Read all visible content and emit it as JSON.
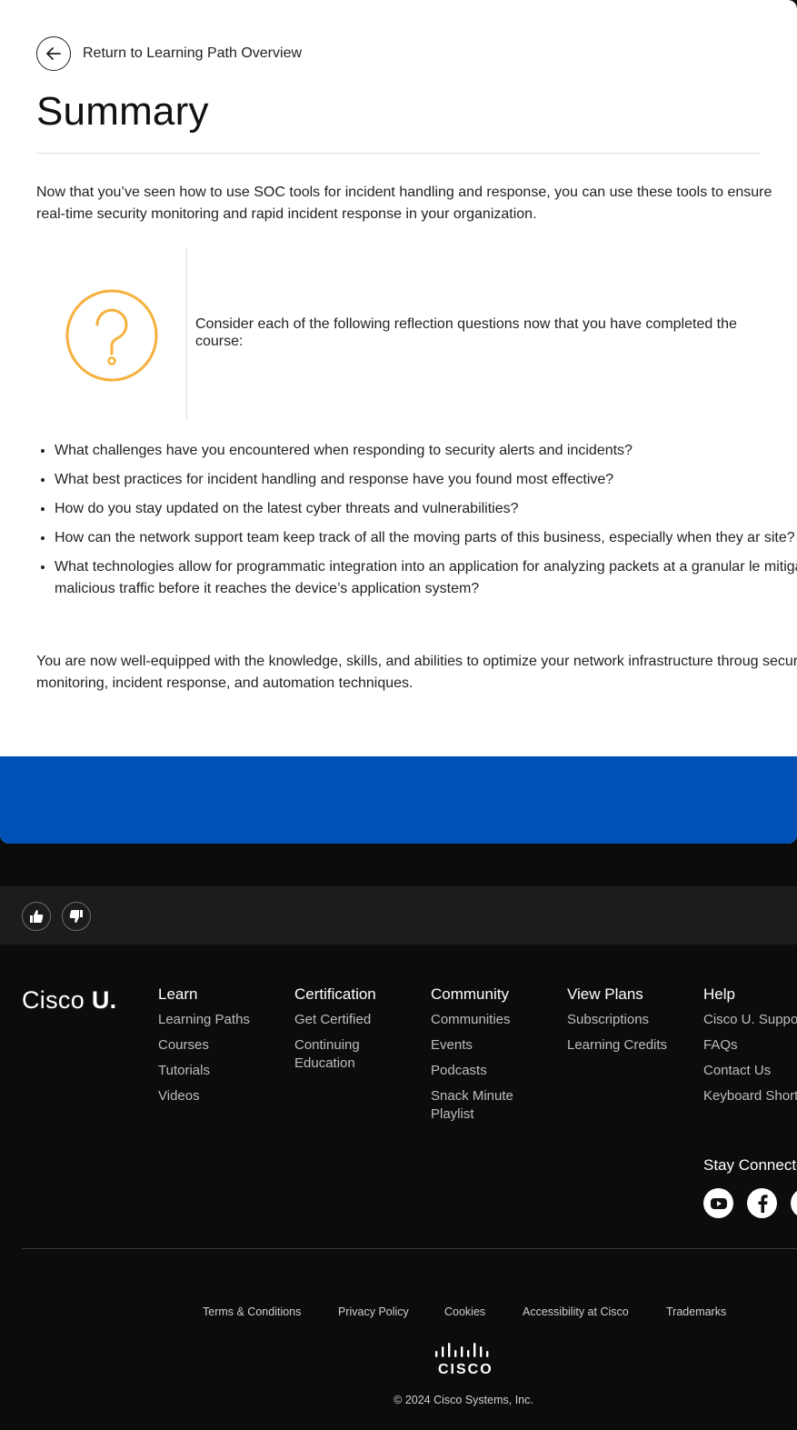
{
  "nav": {
    "back_label": "Return to Learning Path Overview"
  },
  "page": {
    "title": "Summary",
    "intro": "Now that you’ve seen how to use SOC tools for incident handling and response, you can use these tools to ensure real-time security monitoring and rapid incident response in your organization.",
    "callout_text": "Consider each of the following reflection questions now that you have completed the course:",
    "questions": [
      "What challenges have you encountered when responding to security alerts and incidents?",
      "What best practices for incident handling and response have you found most effective?",
      "How do you stay updated on the latest cyber threats and vulnerabilities?",
      "How can the network support team keep track of all the moving parts of this business, especially when they ar site?",
      "What technologies allow for programmatic integration into an application for analyzing packets at a granular le mitigating malicious traffic before it reaches the device’s application system?"
    ],
    "outro": "You are now well-equipped with the knowledge, skills, and abilities to optimize your network infrastructure throug security monitoring, incident response, and automation techniques."
  },
  "footer": {
    "logo": {
      "name": "Cisco",
      "suffix": "U."
    },
    "columns": [
      {
        "heading": "Learn",
        "links": [
          "Learning Paths",
          "Courses",
          "Tutorials",
          "Videos"
        ]
      },
      {
        "heading": "Certification",
        "links": [
          "Get Certified",
          "Continuing Education"
        ]
      },
      {
        "heading": "Community",
        "links": [
          "Communities",
          "Events",
          "Podcasts",
          "Snack Minute Playlist"
        ]
      },
      {
        "heading": "View Plans",
        "links": [
          "Subscriptions",
          "Learning Credits"
        ]
      },
      {
        "heading": "Help",
        "links": [
          "Cisco U. Suppor",
          "FAQs",
          "Contact Us",
          "Keyboard Shortc"
        ]
      }
    ],
    "stay_connected": "Stay Connecte",
    "legal_links": [
      "Terms & Conditions",
      "Privacy Policy",
      "Cookies",
      "Accessibility at Cisco",
      "Trademarks"
    ],
    "cisco_wordmark": "CISCO",
    "copyright": "© 2024 Cisco Systems, Inc."
  },
  "icons": {
    "back": "arrow-left-icon",
    "callout": "question-circle-icon",
    "like": "thumbs-up-icon",
    "dislike": "thumbs-down-icon",
    "social": [
      "youtube-icon",
      "facebook-icon",
      "social-icon"
    ]
  },
  "colors": {
    "accent_blue": "#0051b5",
    "question_icon": "#f5b13d",
    "footer_bg": "#0c0c0c"
  }
}
